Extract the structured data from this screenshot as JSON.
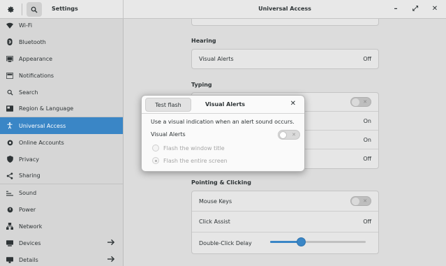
{
  "header": {
    "settings_title": "Settings",
    "panel_title": "Universal Access",
    "window_controls": [
      "–",
      "⤢",
      "✕"
    ]
  },
  "sidebar": {
    "items": [
      {
        "label": "Wi-Fi",
        "icon": "wifi-icon"
      },
      {
        "label": "Bluetooth",
        "icon": "bluetooth-icon"
      },
      {
        "label": "Appearance",
        "icon": "appearance-icon"
      },
      {
        "label": "Notifications",
        "icon": "notifications-icon"
      },
      {
        "label": "Search",
        "icon": "search-icon"
      },
      {
        "label": "Region & Language",
        "icon": "region-icon"
      },
      {
        "label": "Universal Access",
        "icon": "universal-access-icon",
        "active": true
      },
      {
        "label": "Online Accounts",
        "icon": "online-accounts-icon"
      },
      {
        "label": "Privacy",
        "icon": "privacy-icon"
      },
      {
        "label": "Sharing",
        "icon": "sharing-icon"
      },
      {
        "label": "Sound",
        "icon": "sound-icon"
      },
      {
        "label": "Power",
        "icon": "power-icon"
      },
      {
        "label": "Network",
        "icon": "network-icon"
      },
      {
        "label": "Devices",
        "icon": "devices-icon"
      },
      {
        "label": "Details",
        "icon": "details-icon"
      }
    ]
  },
  "main": {
    "hearing": {
      "title": "Hearing",
      "visual_alerts_label": "Visual Alerts",
      "visual_alerts_value": "Off"
    },
    "typing": {
      "title": "Typing",
      "values": [
        "On",
        "On",
        "Off"
      ]
    },
    "pointing": {
      "title": "Pointing & Clicking",
      "mouse_keys_label": "Mouse Keys",
      "click_assist_label": "Click Assist",
      "click_assist_value": "Off",
      "double_click_label": "Double-Click Delay",
      "double_click_level": 0.33
    }
  },
  "dialog": {
    "test_flash_label": "Test flash",
    "title": "Visual Alerts",
    "description": "Use a visual indication when an alert sound occurs.",
    "visual_alerts_label": "Visual Alerts",
    "visual_alerts_enabled": false,
    "options": [
      {
        "label": "Flash the window title",
        "selected": false
      },
      {
        "label": "Flash the entire screen",
        "selected": true
      }
    ]
  },
  "colors": {
    "accent": "#3a86c6",
    "sidebar_bg": "#d6d6d6",
    "header_bg": "#e8e8e8"
  }
}
